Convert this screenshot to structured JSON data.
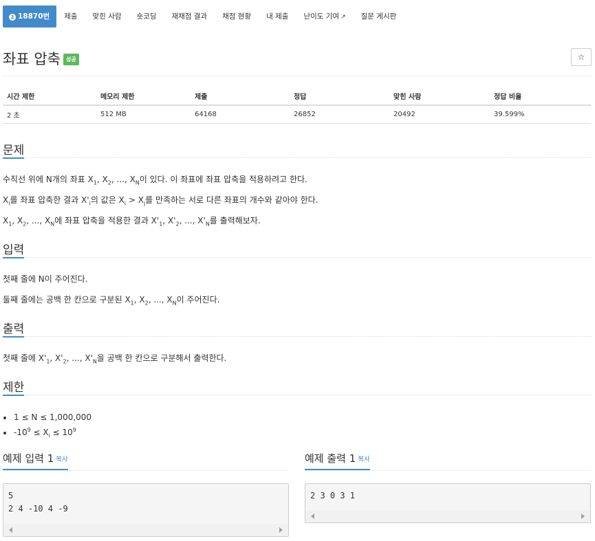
{
  "nav": {
    "problem_id": "18870번",
    "items": [
      "제출",
      "맞힌 사람",
      "숏코딩",
      "재채점 결과",
      "채점 현황",
      "내 제출",
      "난이도 기여",
      "질문 게시판"
    ]
  },
  "problem": {
    "title": "좌표 압축",
    "badge": "성공",
    "star_icon": "☆"
  },
  "info_table": {
    "headers": [
      "시간 제한",
      "메모리 제한",
      "제출",
      "정답",
      "맞힌 사람",
      "정답 비율"
    ],
    "values": [
      "2 초",
      "512 MB",
      "64168",
      "26852",
      "20492",
      "39.599%"
    ]
  },
  "sections": {
    "description": {
      "heading": "문제",
      "p1": {
        "a": "수직선 위에 N개의 좌표 X",
        "b": "이 있다. 이 좌표에 좌표 압축을 적용하려고 한다."
      },
      "p2": {
        "a": "를 좌표 압축한 결과 X'",
        "b": "의 값은 X",
        "c": "를 만족하는 서로 다른 좌표의 개수와 같아야 한다."
      },
      "p3": {
        "a": "에 좌표 압축을 적용한 결과 X'",
        "b": "를 출력해보자."
      }
    },
    "input": {
      "heading": "입력",
      "p1": "첫째 줄에 N이 주어진다.",
      "p2": {
        "a": "둘째 줄에는 공백 한 칸으로 구분된 X",
        "b": "이 주어진다."
      }
    },
    "output": {
      "heading": "출력",
      "p1": {
        "a": "첫째 줄에 X'",
        "b": "을 공백 한 칸으로 구분해서 출력한다."
      }
    },
    "limits": {
      "heading": "제한",
      "l1": "1 ≤ N ≤ 1,000,000",
      "l2": {
        "a": "-10",
        "b": " ≤ X",
        "c": " ≤ 10"
      }
    }
  },
  "samples": {
    "input_title": "예제 입력 1",
    "output_title": "예제 출력 1",
    "copy_label": "복사",
    "input_text": "5\n2 4 -10 4 -9",
    "output_text": "2 3 0 3 1"
  }
}
